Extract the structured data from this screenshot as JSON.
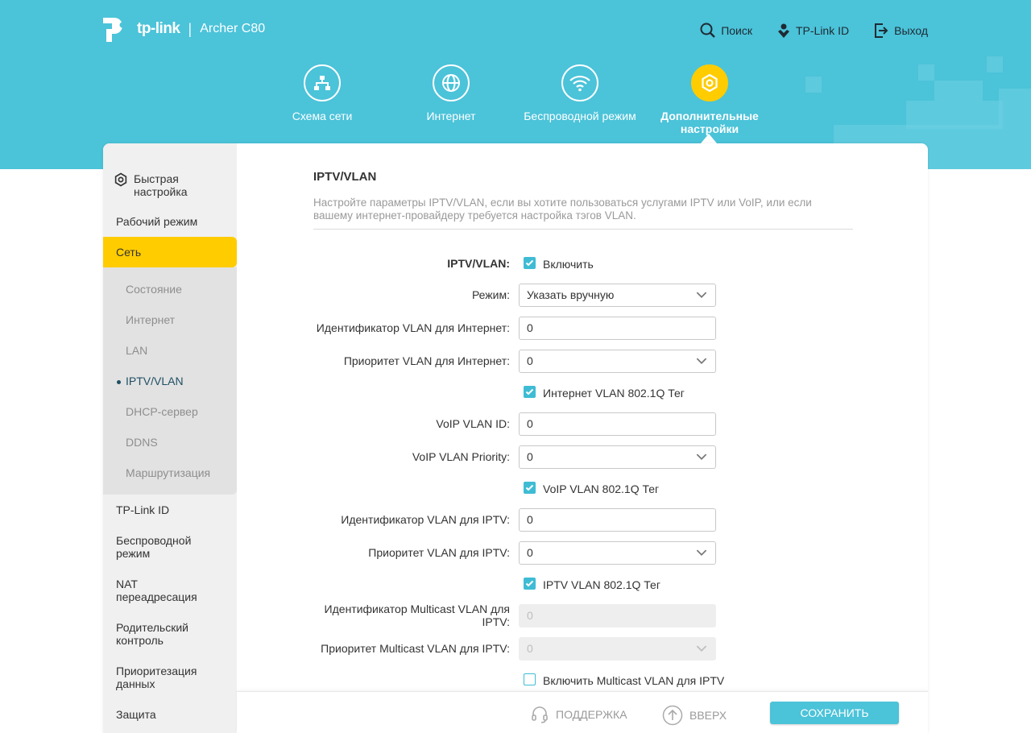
{
  "header": {
    "brand": "tp-link",
    "separator": "|",
    "model": "Archer C80",
    "links": {
      "search": "Поиск",
      "tplink_id": "TP-Link ID",
      "logout": "Выход"
    }
  },
  "nav": {
    "network_map": "Схема сети",
    "internet": "Интернет",
    "wireless": "Беспроводной режим",
    "advanced": "Дополнительные настройки"
  },
  "sidebar": {
    "quick_setup": "Быстрая настройка",
    "operation_mode": "Рабочий режим",
    "network": "Сеть",
    "sub": {
      "status": "Состояние",
      "internet": "Интернет",
      "lan": "LAN",
      "iptv": "IPTV/VLAN",
      "dhcp": "DHCP-сервер",
      "ddns": "DDNS",
      "routing": "Маршрутизация"
    },
    "tplink_id": "TP-Link ID",
    "wireless": "Беспроводной режим",
    "nat": "NAT переадресация",
    "parental": "Родительский контроль",
    "qos": "Приоритезация данных",
    "security": "Защита"
  },
  "content": {
    "title": "IPTV/VLAN",
    "description": "Настройте параметры IPTV/VLAN, если вы хотите пользоваться услугами IPTV или VoIP, или если вашему интернет-провайдеру требуется настройка тэгов VLAN.",
    "form": {
      "iptv_label": "IPTV/VLAN:",
      "iptv_enable": "Включить",
      "mode_label": "Режим:",
      "mode_value": "Указать вручную",
      "inet_vlan_id_label": "Идентификатор VLAN для Интернет:",
      "inet_vlan_id": "0",
      "inet_vlan_prio_label": "Приоритет VLAN для Интернет:",
      "inet_vlan_prio": "0",
      "inet_tag": "Интернет VLAN 802.1Q Тег",
      "voip_id_label": "VoIP VLAN ID:",
      "voip_id": "0",
      "voip_prio_label": "VoIP VLAN Priority:",
      "voip_prio": "0",
      "voip_tag": "VoIP VLAN 802.1Q Тег",
      "iptv_id_label": "Идентификатор VLAN для IPTV:",
      "iptv_id": "0",
      "iptv_prio_label": "Приоритет VLAN для IPTV:",
      "iptv_prio": "0",
      "iptv_tag": "IPTV VLAN 802.1Q Тег",
      "mc_id_label": "Идентификатор Multicast VLAN для IPTV:",
      "mc_id": "0",
      "mc_prio_label": "Приоритет Multicast VLAN для IPTV:",
      "mc_prio": "0",
      "mc_enable": "Включить Multicast VLAN для IPTV"
    }
  },
  "footer": {
    "support": "ПОДДЕРЖКА",
    "top": "ВВЕРХ",
    "save": "СОХРАНИТЬ"
  },
  "colors": {
    "banner": "#4bc3d9",
    "accent": "#ffcc00",
    "checkbox": "#3fbcd4"
  }
}
